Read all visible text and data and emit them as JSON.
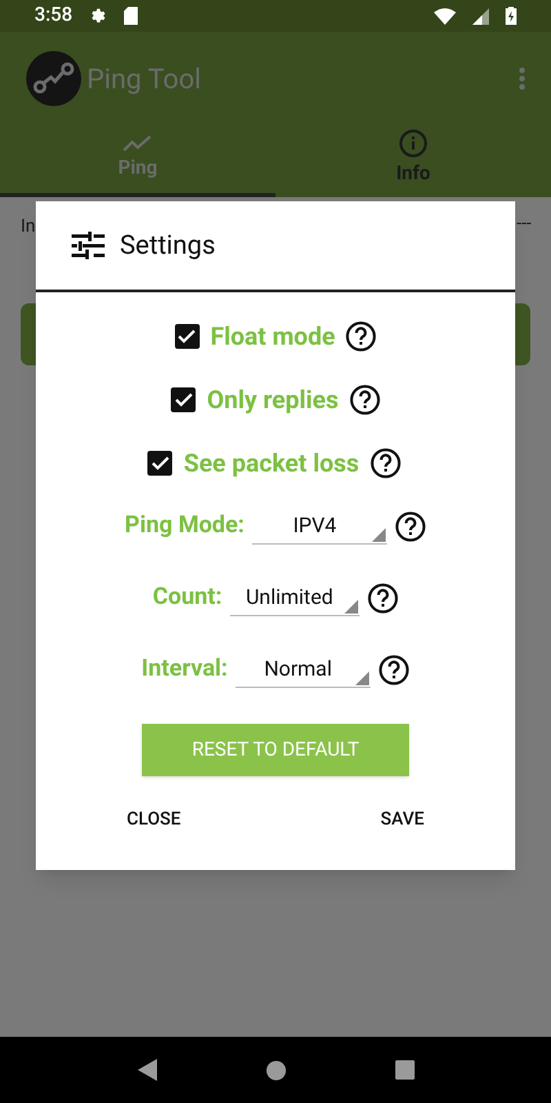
{
  "status_bar": {
    "time": "3:58"
  },
  "app_bar": {
    "title": "Ping Tool"
  },
  "tabs": [
    {
      "label": "Ping",
      "selected": true
    },
    {
      "label": "Info",
      "selected": false
    }
  ],
  "content": {
    "label": "In",
    "dashes": "---"
  },
  "dialog": {
    "title": "Settings",
    "checkboxes": [
      {
        "label": "Float mode",
        "checked": true
      },
      {
        "label": "Only replies",
        "checked": true
      },
      {
        "label": "See packet loss",
        "checked": true
      }
    ],
    "dropdowns": [
      {
        "label": "Ping Mode:",
        "value": "IPV4"
      },
      {
        "label": "Count:",
        "value": "Unlimited"
      },
      {
        "label": "Interval:",
        "value": "Normal"
      }
    ],
    "reset_button": "RESET TO DEFAULT",
    "buttons": [
      "CLOSE",
      "SAVE"
    ]
  }
}
